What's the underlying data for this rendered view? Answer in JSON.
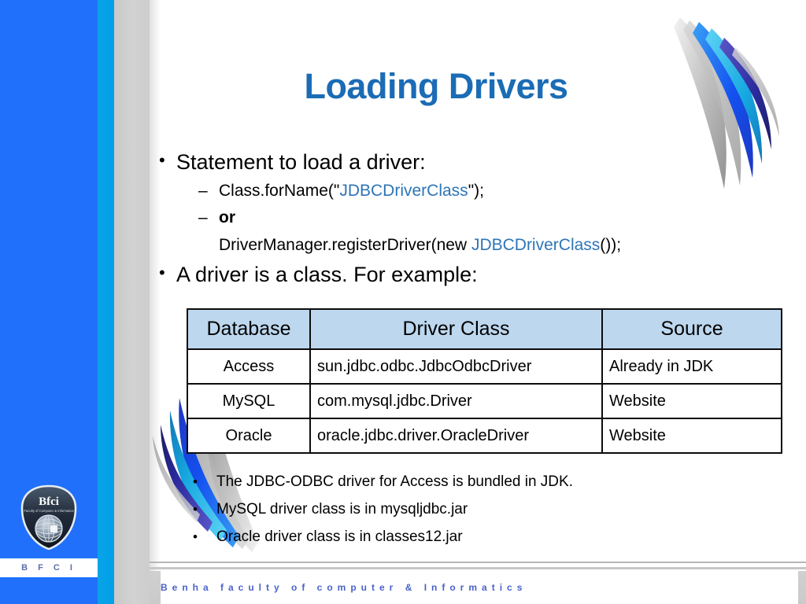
{
  "slide": {
    "title": "Loading Drivers",
    "title_color": "#1b6cb5",
    "accent_code_color": "#2e75b6",
    "band_blue": "#2170fb",
    "band_cyan": "#00a0e8",
    "band_gray": "#cdcdcd",
    "table_header_bg": "#bdd7ee"
  },
  "bullets": {
    "b1": "Statement to load a driver:",
    "b1_sub1_pre": "Class.forName(\"",
    "b1_sub1_code": "JDBCDriverClass",
    "b1_sub1_post": "\");",
    "b1_sub2": "or",
    "b1_sub3_pre": "DriverManager.registerDriver(new ",
    "b1_sub3_code": "JDBCDriverClass",
    "b1_sub3_post": "());",
    "b2": "A driver is a class.  For example:"
  },
  "table": {
    "headers": [
      "Database",
      "Driver Class",
      "Source"
    ],
    "rows": [
      [
        "Access",
        "sun.jdbc.odbc.JdbcOdbcDriver",
        "Already in JDK"
      ],
      [
        "MySQL",
        "com.mysql.jdbc.Driver",
        "Website"
      ],
      [
        "Oracle",
        "oracle.jdbc.driver.OracleDriver",
        "Website"
      ]
    ]
  },
  "notes": [
    "The JDBC-ODBC driver for Access is bundled in JDK.",
    "MySQL driver class is in mysqljdbc.jar",
    "Oracle driver class is in classes12.jar"
  ],
  "footer": {
    "tag": "B F C I",
    "text": "Benha faculty of computer & Informatics"
  },
  "logo": {
    "mark": "Bfci",
    "tagline": "Faculty of Computer & Informatics"
  }
}
